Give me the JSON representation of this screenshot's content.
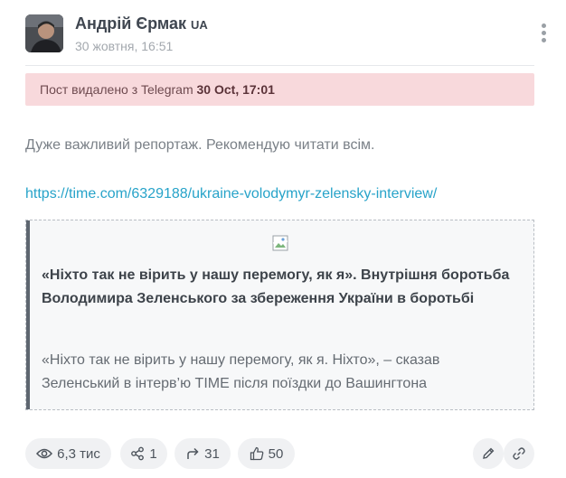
{
  "author": {
    "name": "Андрій Єрмак",
    "flag": "UA",
    "date": "30 жовтня, 16:51"
  },
  "deleted_notice": {
    "text": "Пост видалено з Telegram",
    "time": "30 Oct, 17:01"
  },
  "post": {
    "text": "Дуже важливий репортаж. Рекомендую читати всім.",
    "link": "https://time.com/6329188/ukraine-volodymyr-zelensky-interview/"
  },
  "preview": {
    "title": "«Ніхто так не вірить у нашу перемогу, як я». Внутрішня боротьба Володимира Зеленського за збереження України в боротьбі",
    "description": "«Ніхто так не вірить у нашу перемогу, як я. Ніхто», – сказав Зеленський в інтерв’ю TIME після поїздки до Вашингтона"
  },
  "actions": {
    "views": "6,3 тис",
    "shares": "1",
    "reposts": "31",
    "likes": "50"
  },
  "icons": {
    "views": "eye-icon",
    "shares": "share-icon",
    "reposts": "forward-icon",
    "likes": "thumbs-up-icon",
    "edit": "pencil-icon",
    "copy_link": "link-icon",
    "menu": "kebab-menu-icon"
  }
}
